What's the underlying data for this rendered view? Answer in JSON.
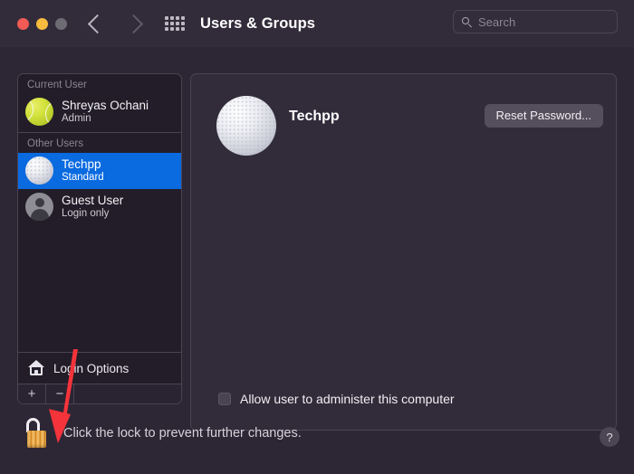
{
  "window": {
    "title": "Users & Groups",
    "traffic_lights": [
      "close",
      "minimize",
      "zoom"
    ],
    "nav": {
      "back": "back-chevron",
      "forward": "forward-chevron"
    },
    "grid_icon": "show-all-grid-icon",
    "search": {
      "placeholder": "Search",
      "value": "",
      "icon": "search-icon"
    }
  },
  "sidebar": {
    "groups": [
      {
        "header": "Current User",
        "users": [
          {
            "name": "Shreyas Ochani",
            "role": "Admin",
            "avatar": "tennis-ball-avatar",
            "selected": false
          }
        ]
      },
      {
        "header": "Other Users",
        "users": [
          {
            "name": "Techpp",
            "role": "Standard",
            "avatar": "golf-ball-avatar",
            "selected": true
          },
          {
            "name": "Guest User",
            "role": "Login only",
            "avatar": "guest-person-avatar",
            "selected": false
          }
        ]
      }
    ],
    "login_options": {
      "label": "Login Options",
      "icon": "home-icon"
    },
    "add_button": "+",
    "remove_button": "−"
  },
  "content": {
    "account_name": "Techpp",
    "account_avatar": "golf-ball-avatar",
    "reset_password_label": "Reset Password...",
    "admin_checkbox": {
      "label": "Allow user to administer this computer",
      "checked": false
    }
  },
  "footer": {
    "lock_icon": "unlocked-padlock-icon",
    "lock_text": "Click the lock to prevent further changes.",
    "help_label": "?"
  },
  "annotation": {
    "arrow": {
      "color": "#f5333a",
      "points_to": "remove-user-button"
    }
  },
  "colors": {
    "window_bg": "#2d2735",
    "titlebar_bg": "#322c3a",
    "sidebar_bg": "#221d29",
    "content_bg": "#322b3a",
    "selection_blue": "#0a6ae0",
    "border": "#4a4452",
    "lock_gold": "#e8a33a",
    "annotation_red": "#f5333a"
  }
}
